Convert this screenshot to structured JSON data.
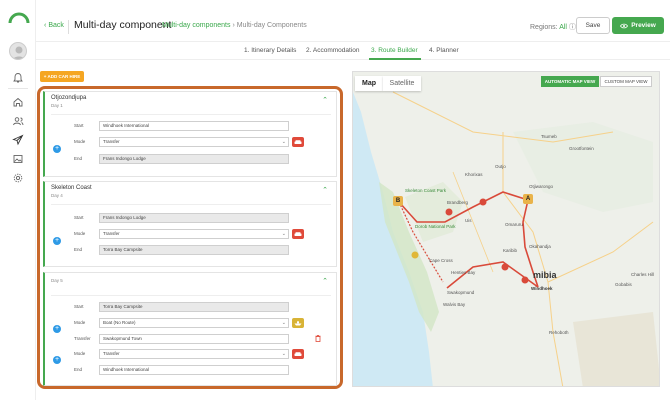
{
  "app": {
    "back_label": "Back",
    "title": "Multi-day component",
    "breadcrumb_link": "Multi-day components",
    "breadcrumb_current": "› Multi-day Components",
    "regions_label": "Regions:",
    "regions_value": "All",
    "save_label": "Save",
    "preview_label": "Preview",
    "accent": "#45a84f",
    "highlight": "#c8682b"
  },
  "tabs": [
    {
      "label": "1. Itinerary Details",
      "active": false
    },
    {
      "label": "2. Accommodation",
      "active": false
    },
    {
      "label": "3. Route Builder",
      "active": true
    },
    {
      "label": "4. Planner",
      "active": false
    }
  ],
  "toolbar": {
    "add_car_hire": "+ ADD CAR HIRE"
  },
  "labels": {
    "start": "Start",
    "mode": "Mode",
    "end": "End",
    "transfer": "Transfer"
  },
  "days": [
    {
      "name": "Otjozondjupa",
      "day": "Day 1",
      "start": "Windhoek International",
      "mode": "Transfer",
      "end": "Frans Indongo Lodge"
    },
    {
      "name": "Skeleton Coast",
      "day": "Day 4",
      "start": "Frans Indongo Lodge",
      "mode": "Transfer",
      "end": "Torra Bay Campsite"
    },
    {
      "name": "",
      "day": "Day 5",
      "start": "Torra Bay Campsite",
      "mode": "Boat (No Route)",
      "transfer": "Swakopmund Town",
      "mode2": "Transfer",
      "end": "Windhoek International"
    }
  ],
  "map": {
    "map_tab": "Map",
    "satellite_tab": "Satellite",
    "auto_view": "AUTOMATIC MAP VIEW",
    "custom_view": "CUSTOM MAP VIEW",
    "marker_a": "A",
    "marker_b": "B",
    "country_label": "mibia",
    "places": {
      "otjiwarongo": "Otjiwarongo",
      "skeleton_coast": "Skeleton Coast Park",
      "dorob": "Dorob National Park",
      "windhoek": "Windhoek",
      "swakopmund": "Swakopmund",
      "walvis_bay": "Walvis Bay",
      "cape_cross": "Cape Cross",
      "henties_bay": "Henties Bay",
      "karibib": "Karibib",
      "okahandja": "Okahandja",
      "omaruru": "Omaruru",
      "uis": "Uis",
      "brandberg": "Brandberg",
      "khorixas": "Khorixas",
      "outjo": "Outjo",
      "grootfontein": "Grootfontein",
      "tsumeb": "Tsumeb",
      "gobabis": "Gobabis",
      "rehoboth": "Rehoboth",
      "charles_hill": "Charles Hill"
    }
  }
}
